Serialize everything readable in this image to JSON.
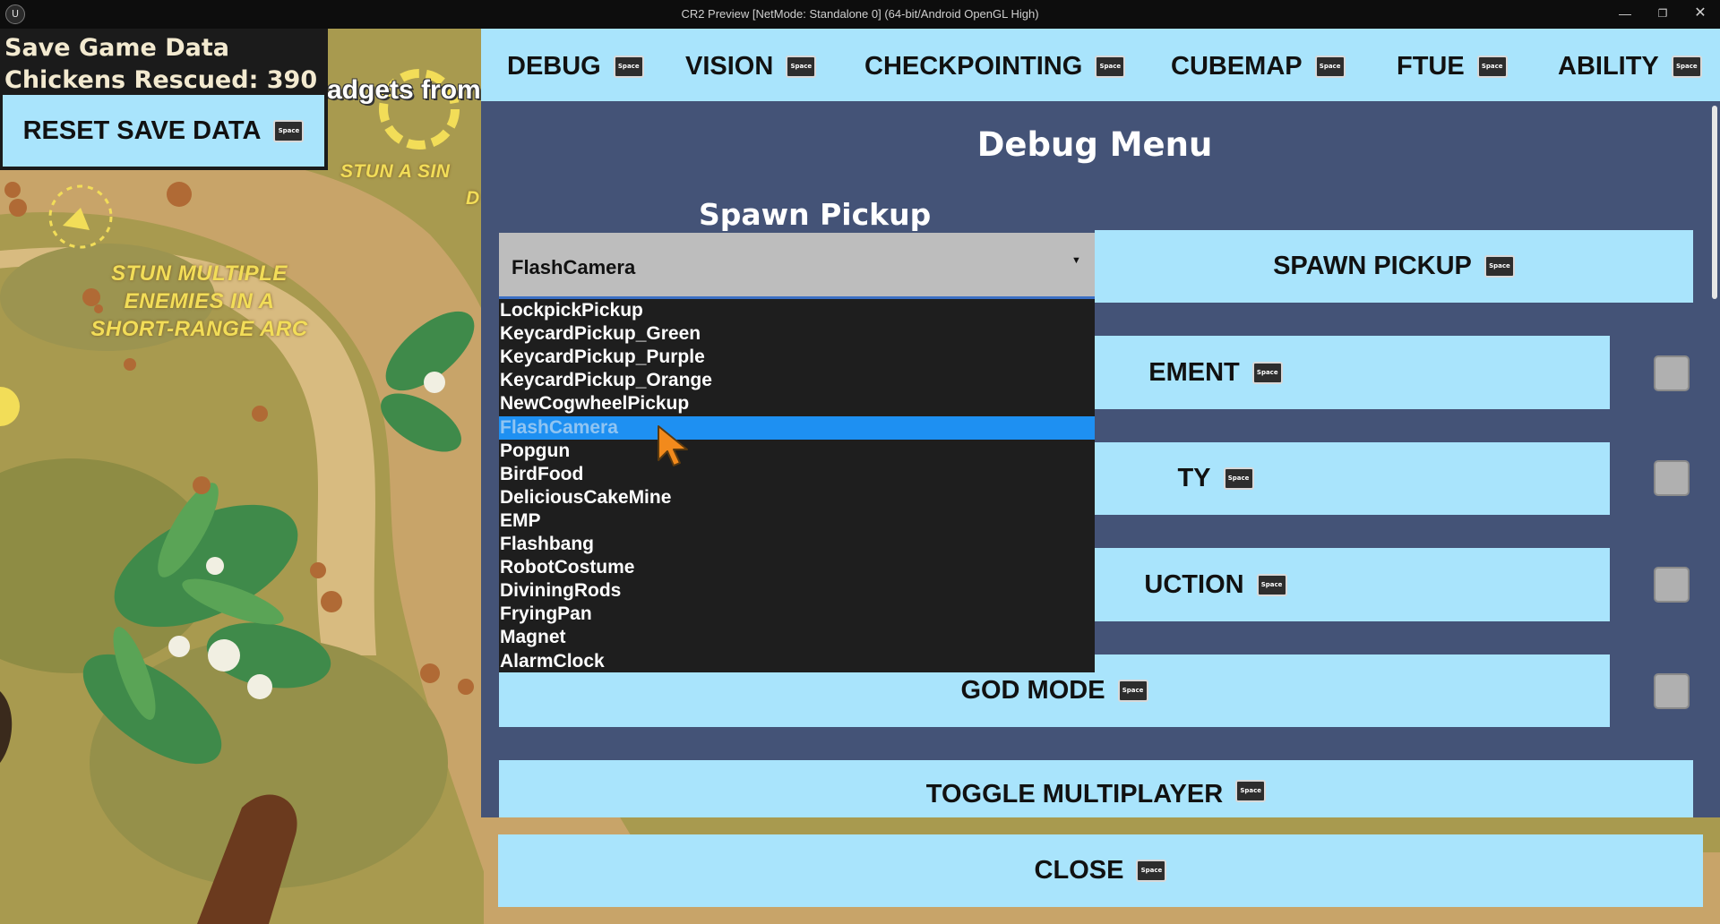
{
  "window": {
    "title": "CR2 Preview [NetMode: Standalone 0]  (64-bit/Android OpenGL High)",
    "logo_icon": "unreal-engine-icon",
    "controls": [
      "minimize-icon",
      "restore-icon",
      "close-icon"
    ]
  },
  "game_hud": {
    "stun_arc_text": [
      "STUN MULTIPLE",
      "ENEMIES IN A",
      "SHORT-RANGE ARC"
    ],
    "stun_single_text": [
      "STUN A SIN",
      "D"
    ],
    "gadgets_text": "adgets from"
  },
  "save_panel": {
    "title": "Save Game Data",
    "chickens_rescued": "Chickens Rescued: 390",
    "reset_label": "RESET SAVE DATA"
  },
  "key_hint": "Space",
  "tabs": [
    {
      "label": "DEBUG"
    },
    {
      "label": "VISION"
    },
    {
      "label": "CHECKPOINTING"
    },
    {
      "label": "CUBEMAP"
    },
    {
      "label": "FTUE"
    },
    {
      "label": "ABILITY"
    }
  ],
  "debug_menu": {
    "title": "Debug Menu",
    "spawn_pickup_label": "Spawn Pickup",
    "spawn_pickup_button": "SPAWN PICKUP",
    "selected_pickup": "FlashCamera",
    "rows": [
      {
        "label": "EMENT",
        "checked": false
      },
      {
        "label": "TY",
        "checked": false
      },
      {
        "label": "UCTION",
        "checked": false
      },
      {
        "label": "GOD MODE",
        "checked": false
      }
    ],
    "toggle_multiplayer": "TOGGLE MULTIPLAYER",
    "close_label": "CLOSE"
  },
  "dropdown_options": [
    "LockpickPickup",
    "KeycardPickup_Green",
    "KeycardPickup_Purple",
    "KeycardPickup_Orange",
    "NewCogwheelPickup",
    "FlashCamera",
    "Popgun",
    "BirdFood",
    "DeliciousCakeMine",
    "EMP",
    "Flashbang",
    "RobotCostume",
    "DiviningRods",
    "FryingPan",
    "Magnet",
    "AlarmClock"
  ],
  "dropdown_highlighted_index": 5,
  "colors": {
    "button_bg": "#a9e4fc",
    "panel_bg": "#445377",
    "highlight": "#1e90f2"
  }
}
